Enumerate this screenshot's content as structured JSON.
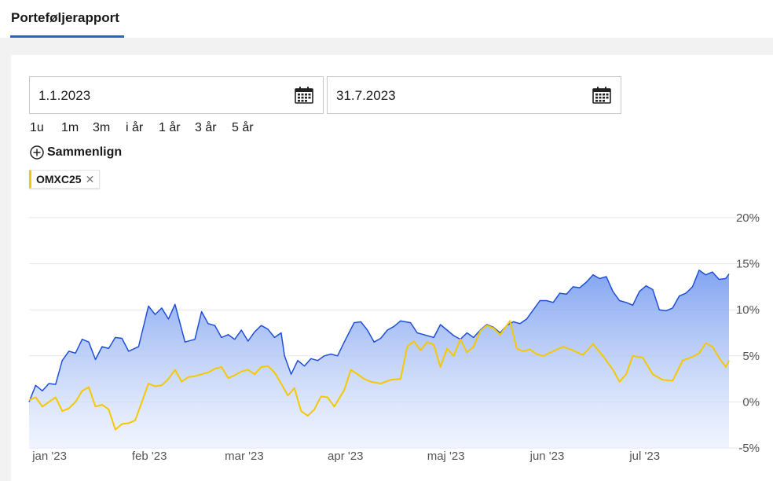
{
  "header": {
    "tab_title": "Porteføljerapport"
  },
  "filters": {
    "from_date": "1.1.2023",
    "to_date": "31.7.2023",
    "ranges": [
      "1u",
      "1m",
      "3m",
      "i år",
      "1 år",
      "3 år",
      "5 år"
    ],
    "compare_label": "Sammenlign",
    "chips": [
      {
        "label": "OMXC25",
        "color": "#f5c800"
      }
    ]
  },
  "icons": {
    "calendar": "calendar-icon",
    "compare": "plus-circle-icon",
    "remove": "close-icon"
  },
  "colors": {
    "accent": "#2f5fd6",
    "portfolio_line": "#1f4fd8",
    "benchmark_line": "#f5c800"
  },
  "chart_data": {
    "type": "area",
    "x_range": [
      "2023-01-01",
      "2023-07-31"
    ],
    "ylim": [
      -5,
      20
    ],
    "y_ticks": [
      20,
      15,
      10,
      5,
      0,
      -5
    ],
    "y_tick_labels": [
      "20%",
      "15%",
      "10%",
      "5%",
      "0%",
      "-5%"
    ],
    "x_ticks": [
      "2023-01-02",
      "2023-02-01",
      "2023-03-01",
      "2023-04-01",
      "2023-05-01",
      "2023-06-01",
      "2023-07-01"
    ],
    "x_tick_labels": [
      "jan '23",
      "feb '23",
      "mar '23",
      "apr '23",
      "maj '23",
      "jun '23",
      "jul '23"
    ],
    "grid": true,
    "series": [
      {
        "color": "#1f4fd8",
        "fill": true,
        "points": [
          [
            "2023-01-01",
            0.0
          ],
          [
            "2023-01-03",
            1.8
          ],
          [
            "2023-01-05",
            1.2
          ],
          [
            "2023-01-07",
            2.0
          ],
          [
            "2023-01-09",
            1.9
          ],
          [
            "2023-01-11",
            4.5
          ],
          [
            "2023-01-13",
            5.5
          ],
          [
            "2023-01-15",
            5.3
          ],
          [
            "2023-01-17",
            6.8
          ],
          [
            "2023-01-19",
            6.5
          ],
          [
            "2023-01-21",
            4.6
          ],
          [
            "2023-01-23",
            6.0
          ],
          [
            "2023-01-25",
            5.8
          ],
          [
            "2023-01-27",
            7.0
          ],
          [
            "2023-01-29",
            6.9
          ],
          [
            "2023-01-31",
            5.5
          ],
          [
            "2023-02-03",
            6.0
          ],
          [
            "2023-02-06",
            10.4
          ],
          [
            "2023-02-08",
            9.5
          ],
          [
            "2023-02-10",
            10.2
          ],
          [
            "2023-02-12",
            9.0
          ],
          [
            "2023-02-14",
            10.6
          ],
          [
            "2023-02-17",
            6.5
          ],
          [
            "2023-02-20",
            6.8
          ],
          [
            "2023-02-22",
            9.8
          ],
          [
            "2023-02-24",
            8.5
          ],
          [
            "2023-02-26",
            8.3
          ],
          [
            "2023-02-28",
            7.0
          ],
          [
            "2023-03-02",
            7.3
          ],
          [
            "2023-03-04",
            6.8
          ],
          [
            "2023-03-06",
            7.8
          ],
          [
            "2023-03-08",
            6.6
          ],
          [
            "2023-03-10",
            7.6
          ],
          [
            "2023-03-12",
            8.3
          ],
          [
            "2023-03-14",
            7.9
          ],
          [
            "2023-03-16",
            7.0
          ],
          [
            "2023-03-18",
            7.5
          ],
          [
            "2023-03-19",
            5.0
          ],
          [
            "2023-03-21",
            3.0
          ],
          [
            "2023-03-23",
            4.5
          ],
          [
            "2023-03-25",
            3.9
          ],
          [
            "2023-03-27",
            4.7
          ],
          [
            "2023-03-29",
            4.5
          ],
          [
            "2023-03-31",
            5.0
          ],
          [
            "2023-04-02",
            5.2
          ],
          [
            "2023-04-04",
            5.0
          ],
          [
            "2023-04-06",
            6.5
          ],
          [
            "2023-04-09",
            8.6
          ],
          [
            "2023-04-11",
            8.7
          ],
          [
            "2023-04-13",
            7.8
          ],
          [
            "2023-04-15",
            6.5
          ],
          [
            "2023-04-17",
            6.9
          ],
          [
            "2023-04-19",
            7.8
          ],
          [
            "2023-04-21",
            8.2
          ],
          [
            "2023-04-23",
            8.8
          ],
          [
            "2023-04-26",
            8.6
          ],
          [
            "2023-04-28",
            7.5
          ],
          [
            "2023-04-30",
            7.3
          ],
          [
            "2023-05-03",
            7.0
          ],
          [
            "2023-05-05",
            8.4
          ],
          [
            "2023-05-07",
            7.8
          ],
          [
            "2023-05-09",
            7.2
          ],
          [
            "2023-05-11",
            6.8
          ],
          [
            "2023-05-13",
            7.5
          ],
          [
            "2023-05-15",
            7.0
          ],
          [
            "2023-05-17",
            7.8
          ],
          [
            "2023-05-19",
            8.4
          ],
          [
            "2023-05-21",
            8.1
          ],
          [
            "2023-05-23",
            7.5
          ],
          [
            "2023-05-25",
            8.3
          ],
          [
            "2023-05-27",
            8.7
          ],
          [
            "2023-05-29",
            8.5
          ],
          [
            "2023-05-31",
            9.0
          ],
          [
            "2023-06-02",
            10.0
          ],
          [
            "2023-06-04",
            11.0
          ],
          [
            "2023-06-06",
            11.0
          ],
          [
            "2023-06-08",
            10.8
          ],
          [
            "2023-06-10",
            11.8
          ],
          [
            "2023-06-12",
            11.7
          ],
          [
            "2023-06-14",
            12.5
          ],
          [
            "2023-06-16",
            12.4
          ],
          [
            "2023-06-18",
            13.0
          ],
          [
            "2023-06-20",
            13.8
          ],
          [
            "2023-06-22",
            13.4
          ],
          [
            "2023-06-24",
            13.6
          ],
          [
            "2023-06-26",
            12.0
          ],
          [
            "2023-06-28",
            11.0
          ],
          [
            "2023-06-30",
            10.8
          ],
          [
            "2023-07-02",
            10.5
          ],
          [
            "2023-07-04",
            12.0
          ],
          [
            "2023-07-06",
            12.6
          ],
          [
            "2023-07-08",
            12.2
          ],
          [
            "2023-07-10",
            10.0
          ],
          [
            "2023-07-12",
            9.9
          ],
          [
            "2023-07-14",
            10.2
          ],
          [
            "2023-07-16",
            11.5
          ],
          [
            "2023-07-18",
            11.8
          ],
          [
            "2023-07-20",
            12.5
          ],
          [
            "2023-07-22",
            14.3
          ],
          [
            "2023-07-24",
            13.8
          ],
          [
            "2023-07-26",
            14.1
          ],
          [
            "2023-07-28",
            13.3
          ],
          [
            "2023-07-30",
            13.4
          ],
          [
            "2023-07-31",
            13.9
          ]
        ]
      },
      {
        "color": "#f5c800",
        "fill": false,
        "points": [
          [
            "2023-01-01",
            0.2
          ],
          [
            "2023-01-03",
            0.5
          ],
          [
            "2023-01-05",
            -0.5
          ],
          [
            "2023-01-07",
            0.0
          ],
          [
            "2023-01-09",
            0.5
          ],
          [
            "2023-01-11",
            -1.0
          ],
          [
            "2023-01-13",
            -0.7
          ],
          [
            "2023-01-15",
            0.0
          ],
          [
            "2023-01-17",
            1.2
          ],
          [
            "2023-01-19",
            1.6
          ],
          [
            "2023-01-21",
            -0.5
          ],
          [
            "2023-01-23",
            -0.3
          ],
          [
            "2023-01-25",
            -0.8
          ],
          [
            "2023-01-27",
            -3.0
          ],
          [
            "2023-01-29",
            -2.4
          ],
          [
            "2023-01-31",
            -2.3
          ],
          [
            "2023-02-02",
            -2.0
          ],
          [
            "2023-02-04",
            0.0
          ],
          [
            "2023-02-06",
            2.0
          ],
          [
            "2023-02-08",
            1.7
          ],
          [
            "2023-02-10",
            1.8
          ],
          [
            "2023-02-12",
            2.5
          ],
          [
            "2023-02-14",
            3.5
          ],
          [
            "2023-02-16",
            2.2
          ],
          [
            "2023-02-18",
            2.7
          ],
          [
            "2023-02-20",
            2.8
          ],
          [
            "2023-02-22",
            3.0
          ],
          [
            "2023-02-24",
            3.2
          ],
          [
            "2023-02-26",
            3.6
          ],
          [
            "2023-02-28",
            3.8
          ],
          [
            "2023-03-02",
            2.6
          ],
          [
            "2023-03-04",
            2.9
          ],
          [
            "2023-03-06",
            3.3
          ],
          [
            "2023-03-08",
            3.5
          ],
          [
            "2023-03-10",
            3.0
          ],
          [
            "2023-03-12",
            3.8
          ],
          [
            "2023-03-14",
            3.9
          ],
          [
            "2023-03-16",
            3.2
          ],
          [
            "2023-03-18",
            2.0
          ],
          [
            "2023-03-20",
            0.7
          ],
          [
            "2023-03-22",
            1.5
          ],
          [
            "2023-03-24",
            -1.0
          ],
          [
            "2023-03-26",
            -1.5
          ],
          [
            "2023-03-28",
            -0.8
          ],
          [
            "2023-03-30",
            0.6
          ],
          [
            "2023-04-01",
            0.5
          ],
          [
            "2023-04-03",
            -0.5
          ],
          [
            "2023-04-06",
            1.3
          ],
          [
            "2023-04-08",
            3.5
          ],
          [
            "2023-04-10",
            3.0
          ],
          [
            "2023-04-12",
            2.5
          ],
          [
            "2023-04-14",
            2.2
          ],
          [
            "2023-04-17",
            2.0
          ],
          [
            "2023-04-20",
            2.4
          ],
          [
            "2023-04-23",
            2.5
          ],
          [
            "2023-04-25",
            6.0
          ],
          [
            "2023-04-27",
            6.6
          ],
          [
            "2023-04-29",
            5.6
          ],
          [
            "2023-05-01",
            6.5
          ],
          [
            "2023-05-03",
            6.2
          ],
          [
            "2023-05-05",
            3.8
          ],
          [
            "2023-05-07",
            5.8
          ],
          [
            "2023-05-09",
            5.0
          ],
          [
            "2023-05-11",
            6.8
          ],
          [
            "2023-05-13",
            5.4
          ],
          [
            "2023-05-15",
            6.0
          ],
          [
            "2023-05-17",
            7.7
          ],
          [
            "2023-05-19",
            8.3
          ],
          [
            "2023-05-21",
            8.0
          ],
          [
            "2023-05-23",
            7.3
          ],
          [
            "2023-05-26",
            8.8
          ],
          [
            "2023-05-28",
            5.8
          ],
          [
            "2023-05-30",
            5.5
          ],
          [
            "2023-06-01",
            5.7
          ],
          [
            "2023-06-03",
            5.2
          ],
          [
            "2023-06-05",
            5.0
          ],
          [
            "2023-06-08",
            5.5
          ],
          [
            "2023-06-11",
            6.0
          ],
          [
            "2023-06-14",
            5.6
          ],
          [
            "2023-06-17",
            5.1
          ],
          [
            "2023-06-20",
            6.3
          ],
          [
            "2023-06-23",
            5.0
          ],
          [
            "2023-06-26",
            3.5
          ],
          [
            "2023-06-28",
            2.2
          ],
          [
            "2023-06-30",
            3.0
          ],
          [
            "2023-07-02",
            5.0
          ],
          [
            "2023-07-05",
            4.8
          ],
          [
            "2023-07-08",
            3.0
          ],
          [
            "2023-07-11",
            2.4
          ],
          [
            "2023-07-14",
            2.3
          ],
          [
            "2023-07-17",
            4.5
          ],
          [
            "2023-07-20",
            4.9
          ],
          [
            "2023-07-22",
            5.3
          ],
          [
            "2023-07-24",
            6.4
          ],
          [
            "2023-07-26",
            6.0
          ],
          [
            "2023-07-28",
            4.8
          ],
          [
            "2023-07-30",
            3.8
          ],
          [
            "2023-07-31",
            4.5
          ]
        ]
      }
    ]
  }
}
